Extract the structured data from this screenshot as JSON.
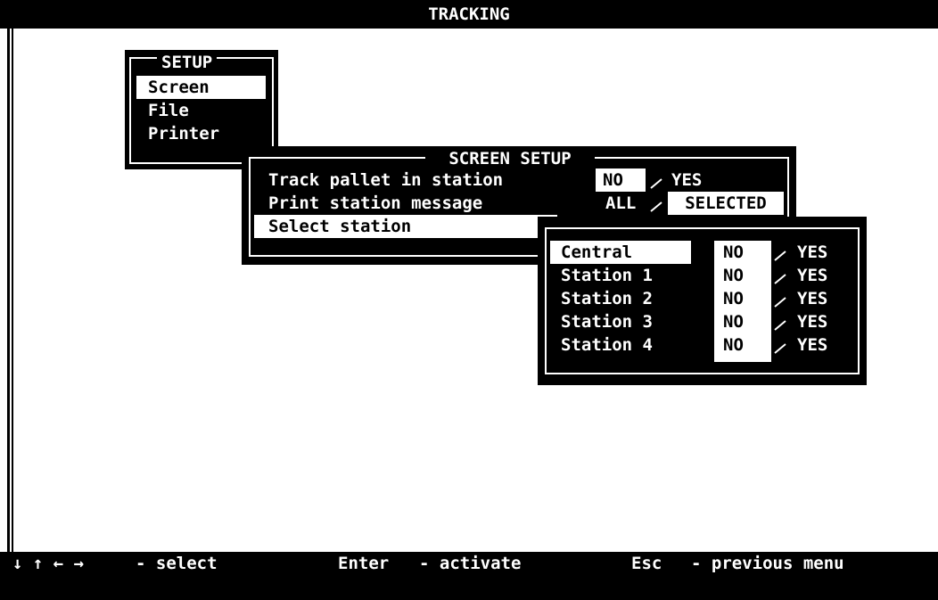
{
  "title": "TRACKING",
  "setup_menu": {
    "title": "SETUP",
    "items": [
      "Screen",
      "File",
      "Printer"
    ]
  },
  "screen_setup": {
    "title": "SCREEN SETUP",
    "rows": [
      {
        "label": "Track pallet in station",
        "option_a": "NO",
        "option_b": "YES",
        "selected": "NO"
      },
      {
        "label": "Print station message",
        "option_a": "ALL",
        "option_b": "SELECTED",
        "selected": "SELECTED"
      }
    ],
    "select_station_label": "Select station",
    "separator": "/"
  },
  "stations": [
    {
      "name": "Central",
      "no": "NO",
      "yes": "YES",
      "selected": "NO"
    },
    {
      "name": "Station 1",
      "no": "NO",
      "yes": "YES",
      "selected": "NO"
    },
    {
      "name": "Station 2",
      "no": "NO",
      "yes": "YES",
      "selected": "NO"
    },
    {
      "name": "Station 3",
      "no": "NO",
      "yes": "YES",
      "selected": "NO"
    },
    {
      "name": "Station 4",
      "no": "NO",
      "yes": "YES",
      "selected": "NO"
    }
  ],
  "footer": {
    "arrows": "↓ ↑ ← →",
    "select_hint": "- select",
    "enter_key": "Enter",
    "enter_hint": "- activate",
    "esc_key": "Esc",
    "esc_hint": "- previous menu"
  }
}
